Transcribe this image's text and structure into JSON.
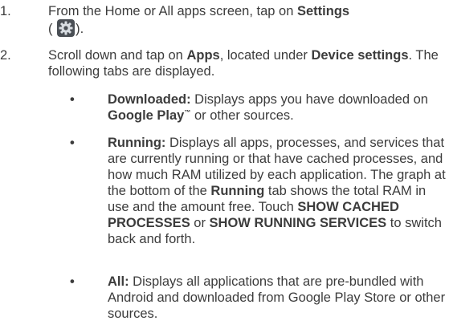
{
  "steps": [
    {
      "number": "1.",
      "text_a": "From the Home or All apps screen, tap on ",
      "bold_a": "Settings",
      "text_b": "(",
      "icon": "settings-gear-icon",
      "text_c": ")."
    },
    {
      "number": "2.",
      "text_a": "Scroll down and tap on ",
      "bold_a": "Apps",
      "text_b": ", located under ",
      "bold_b": "Device settings",
      "text_c": ". The following tabs are displayed."
    }
  ],
  "bullets": [
    {
      "symbol": "•",
      "label": "Downloaded:",
      "text_a": " Displays apps you have downloaded on ",
      "bold_a": "Google Play",
      "trademark": "™",
      "text_b": " or other sources."
    },
    {
      "symbol": "•",
      "label": "Running:",
      "text_a": " Displays all apps, processes, and services that are currently running or that have cached processes, and how much RAM utilized by each application. The graph at the bottom of the ",
      "bold_a": "Running",
      "text_b": " tab shows the total RAM in use and the amount free. Touch ",
      "bold_b": "SHOW CACHED PROCESSES",
      "text_c": " or ",
      "bold_c": "SHOW RUNNING SERVICES",
      "text_d": " to switch back and forth."
    },
    {
      "symbol": "•",
      "label": "All:",
      "text_a": " Displays all applications that are pre-bundled with Android and downloaded from Google Play Store or other sources."
    }
  ],
  "colors": {
    "text": "#3c3c3c",
    "icon_bg": "#4a4f55",
    "icon_gear": "#d8dde2"
  }
}
